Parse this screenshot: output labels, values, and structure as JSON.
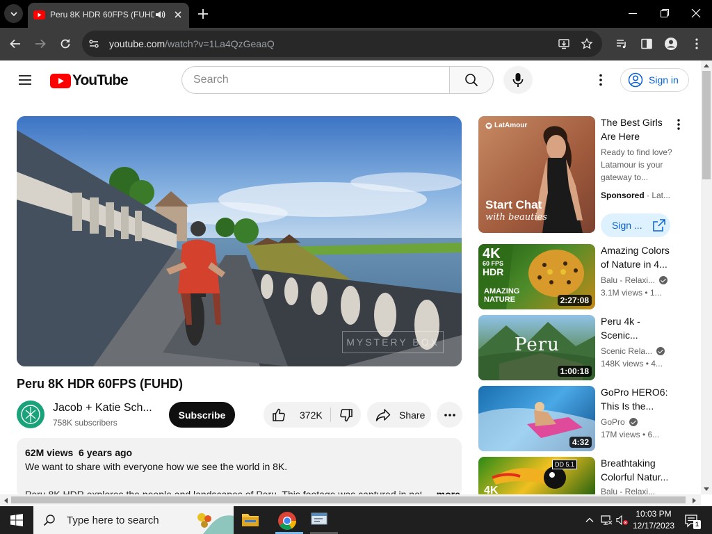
{
  "browser": {
    "tab_title": "Peru 8K HDR 60FPS (FUHD)",
    "url_host": "youtube.com",
    "url_path": "/watch?v=1La4QzGeaaQ"
  },
  "youtube": {
    "logo_text": "YouTube",
    "search_placeholder": "Search",
    "signin_label": "Sign in"
  },
  "video": {
    "title": "Peru 8K HDR 60FPS (FUHD)",
    "watermark": "MYSTERY BOX",
    "channel_name": "Jacob + Katie Sch...",
    "subscribers": "758K subscribers",
    "subscribe_label": "Subscribe",
    "like_count": "372K",
    "share_label": "Share",
    "description": {
      "meta": "62M views  6 years ago",
      "line1": "We want to share with everyone how we see the world in 8K.",
      "line2": "Peru 8K HDR explores the people and landscapes of Peru. This footage was captured in not...",
      "more_label": "...more"
    }
  },
  "sidebar": {
    "ad": {
      "thumb_brand": "LatAmour",
      "thumb_line1": "Start Chat",
      "thumb_line2": "with beauties",
      "title": "The Best Girls Are Here",
      "description": "Ready to find love? Latamour is your gateway to...",
      "sponsored": "Sponsored",
      "advertiser": " · Lat...",
      "cta_label": "Sign ..."
    },
    "videos": [
      {
        "title": "Amazing Colors of Nature in 4...",
        "channel": "Balu - Relaxi...",
        "views": "3.1M views  • 1...",
        "duration": "2:27:08"
      },
      {
        "title": "Peru 4k - Scenic...",
        "channel": "Scenic Rela...",
        "views": "148K views  • 4...",
        "duration": "1:00:18"
      },
      {
        "title": "GoPro HERO6: This Is the...",
        "channel": "GoPro",
        "views": "17M views  • 6...",
        "duration": "4:32"
      },
      {
        "title": "Breathtaking Colorful Natur...",
        "channel": "Balu - Relaxi...",
        "views": "",
        "duration": ""
      }
    ]
  },
  "taskbar": {
    "search_label": "Type here to search",
    "time": "10:03 PM",
    "date": "12/17/2023",
    "notification_count": "1"
  }
}
